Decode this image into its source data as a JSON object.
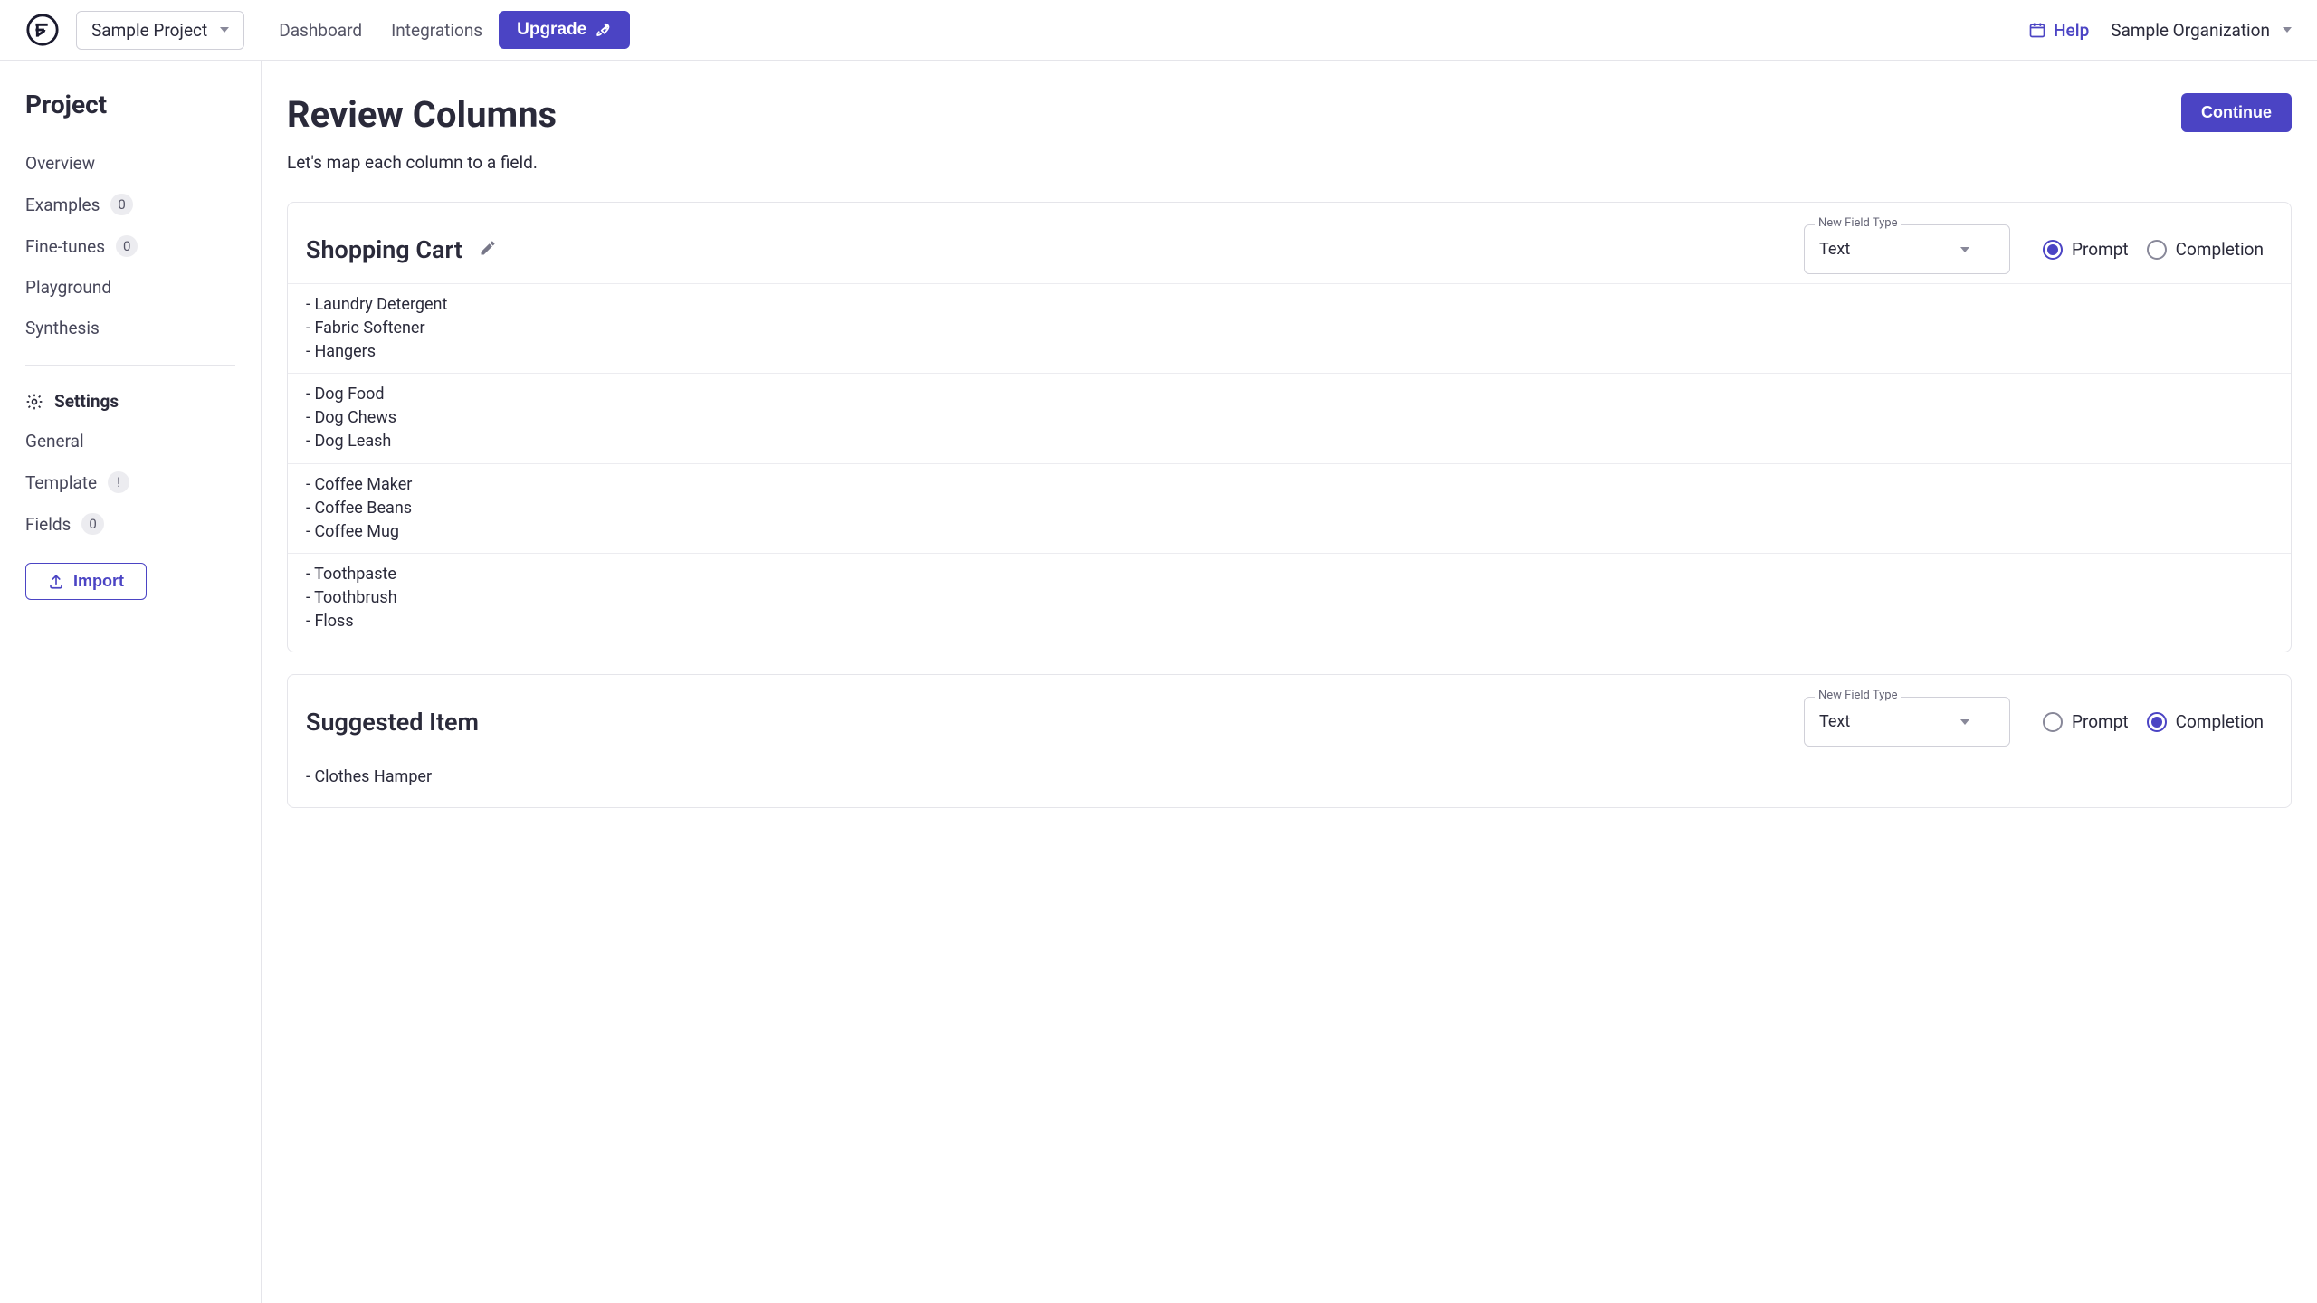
{
  "topbar": {
    "project_label": "Sample Project",
    "nav": {
      "dashboard": "Dashboard",
      "integrations": "Integrations"
    },
    "upgrade_label": "Upgrade",
    "help_label": "Help",
    "org_label": "Sample Organization"
  },
  "sidebar": {
    "heading": "Project",
    "items": [
      {
        "label": "Overview",
        "badge": null
      },
      {
        "label": "Examples",
        "badge": "0"
      },
      {
        "label": "Fine-tunes",
        "badge": "0"
      },
      {
        "label": "Playground",
        "badge": null
      },
      {
        "label": "Synthesis",
        "badge": null
      }
    ],
    "settings_heading": "Settings",
    "settings": [
      {
        "label": "General",
        "badge": null
      },
      {
        "label": "Template",
        "badge": "!"
      },
      {
        "label": "Fields",
        "badge": "0"
      }
    ],
    "import_label": "Import"
  },
  "main": {
    "title": "Review Columns",
    "subtitle": "Let's map each column to a field.",
    "continue_label": "Continue",
    "field_type_label": "New Field Type",
    "field_type_value": "Text",
    "radio_prompt": "Prompt",
    "radio_completion": "Completion",
    "columns": [
      {
        "name": "Shopping Cart",
        "field_type": "Text",
        "selected": "prompt",
        "samples": [
          "- Laundry Detergent\n- Fabric Softener\n- Hangers",
          "- Dog Food\n- Dog Chews\n- Dog Leash",
          "- Coffee Maker\n- Coffee Beans\n- Coffee Mug",
          "- Toothpaste\n- Toothbrush\n- Floss"
        ]
      },
      {
        "name": "Suggested Item",
        "field_type": "Text",
        "selected": "completion",
        "samples": [
          "- Clothes Hamper"
        ]
      }
    ]
  }
}
